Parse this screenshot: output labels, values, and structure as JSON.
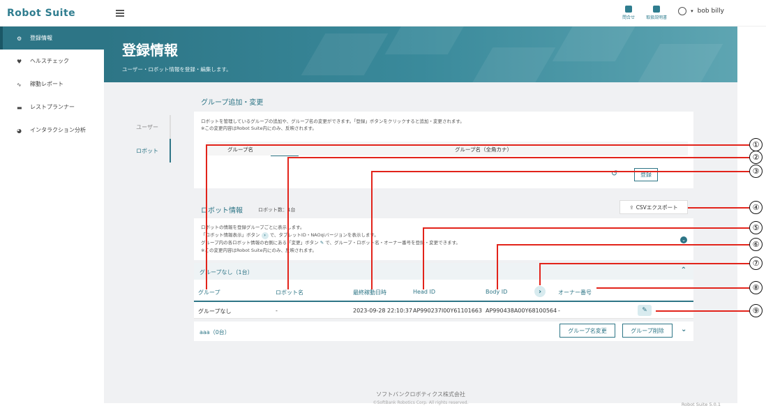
{
  "app": {
    "logo": "Robot Suite"
  },
  "top": {
    "contact_label": "問合せ",
    "manual_label": "取扱説明書",
    "user_name": "bob billy"
  },
  "sidebar": {
    "items": [
      {
        "label": "登録情報"
      },
      {
        "label": "ヘルスチェック"
      },
      {
        "label": "稼動レポート"
      },
      {
        "label": "レストプランナー"
      },
      {
        "label": "インタラクション分析"
      }
    ]
  },
  "hero": {
    "title": "登録情報",
    "subtitle": "ユーザー・ロボット情報を登録・編集します。"
  },
  "tabs": {
    "user": "ユーザー",
    "robot": "ロボット"
  },
  "group_add": {
    "title": "グループ追加・変更",
    "desc1": "ロボットを管理しているグループの追加や、グループ名の変更ができます。「登録」ボタンをクリックすると追加・変更されます。",
    "desc2": "※この変更内容はRobot Suite内にのみ、反映されます。",
    "col_name": "グループ名",
    "col_kana": "グループ名（全角カナ）",
    "register_label": "登録"
  },
  "robot_info": {
    "title": "ロボット情報",
    "count": "ロボット数：1台",
    "csv_label": "CSVエクスポート",
    "desc1": "ロボットの情報を登録グループごとに表示します。",
    "desc2a": "「ロボット情報表示」ボタン",
    "desc2b": "で、タブレットID・NAOqiバージョンを表示します。",
    "desc3a": "グループ内の各ロボット情報の右側にある「変更」ボタン",
    "desc3b": "で、グループ・ロボット名・オーナー番号を登録・変更できます。",
    "desc4": "※この変更内容はRobot Suite内にのみ、反映されます。"
  },
  "group_none": {
    "label": "グループなし（1台）",
    "headers": {
      "group": "グループ",
      "robot_name": "ロボット名",
      "last_active": "最終稼動日時",
      "head_id": "Head ID",
      "body_id": "Body ID",
      "owner": "オーナー番号"
    },
    "rows": [
      {
        "group": "グループなし",
        "robot_name": "-",
        "last_active": "2023-09-28 22:10:37",
        "head_id": "AP990237I00Y61101663",
        "body_id": "AP990438A00Y68100564",
        "owner": "-"
      }
    ]
  },
  "group_aaa": {
    "label": "aaa（0台）",
    "rename_label": "グループ名変更",
    "delete_label": "グループ削除"
  },
  "footer": {
    "company": "ソフトバンクロボティクス株式会社",
    "copyright": "©SoftBank Robotics Corp. All rights reserved.",
    "version": "Robot Suite 5.0.1"
  },
  "callouts": [
    "①",
    "②",
    "③",
    "④",
    "⑤",
    "⑥",
    "⑦",
    "⑧",
    "⑨"
  ],
  "colors": {
    "accent": "#2d7586",
    "callout": "#e2231a",
    "background": "#f0f1f3"
  }
}
